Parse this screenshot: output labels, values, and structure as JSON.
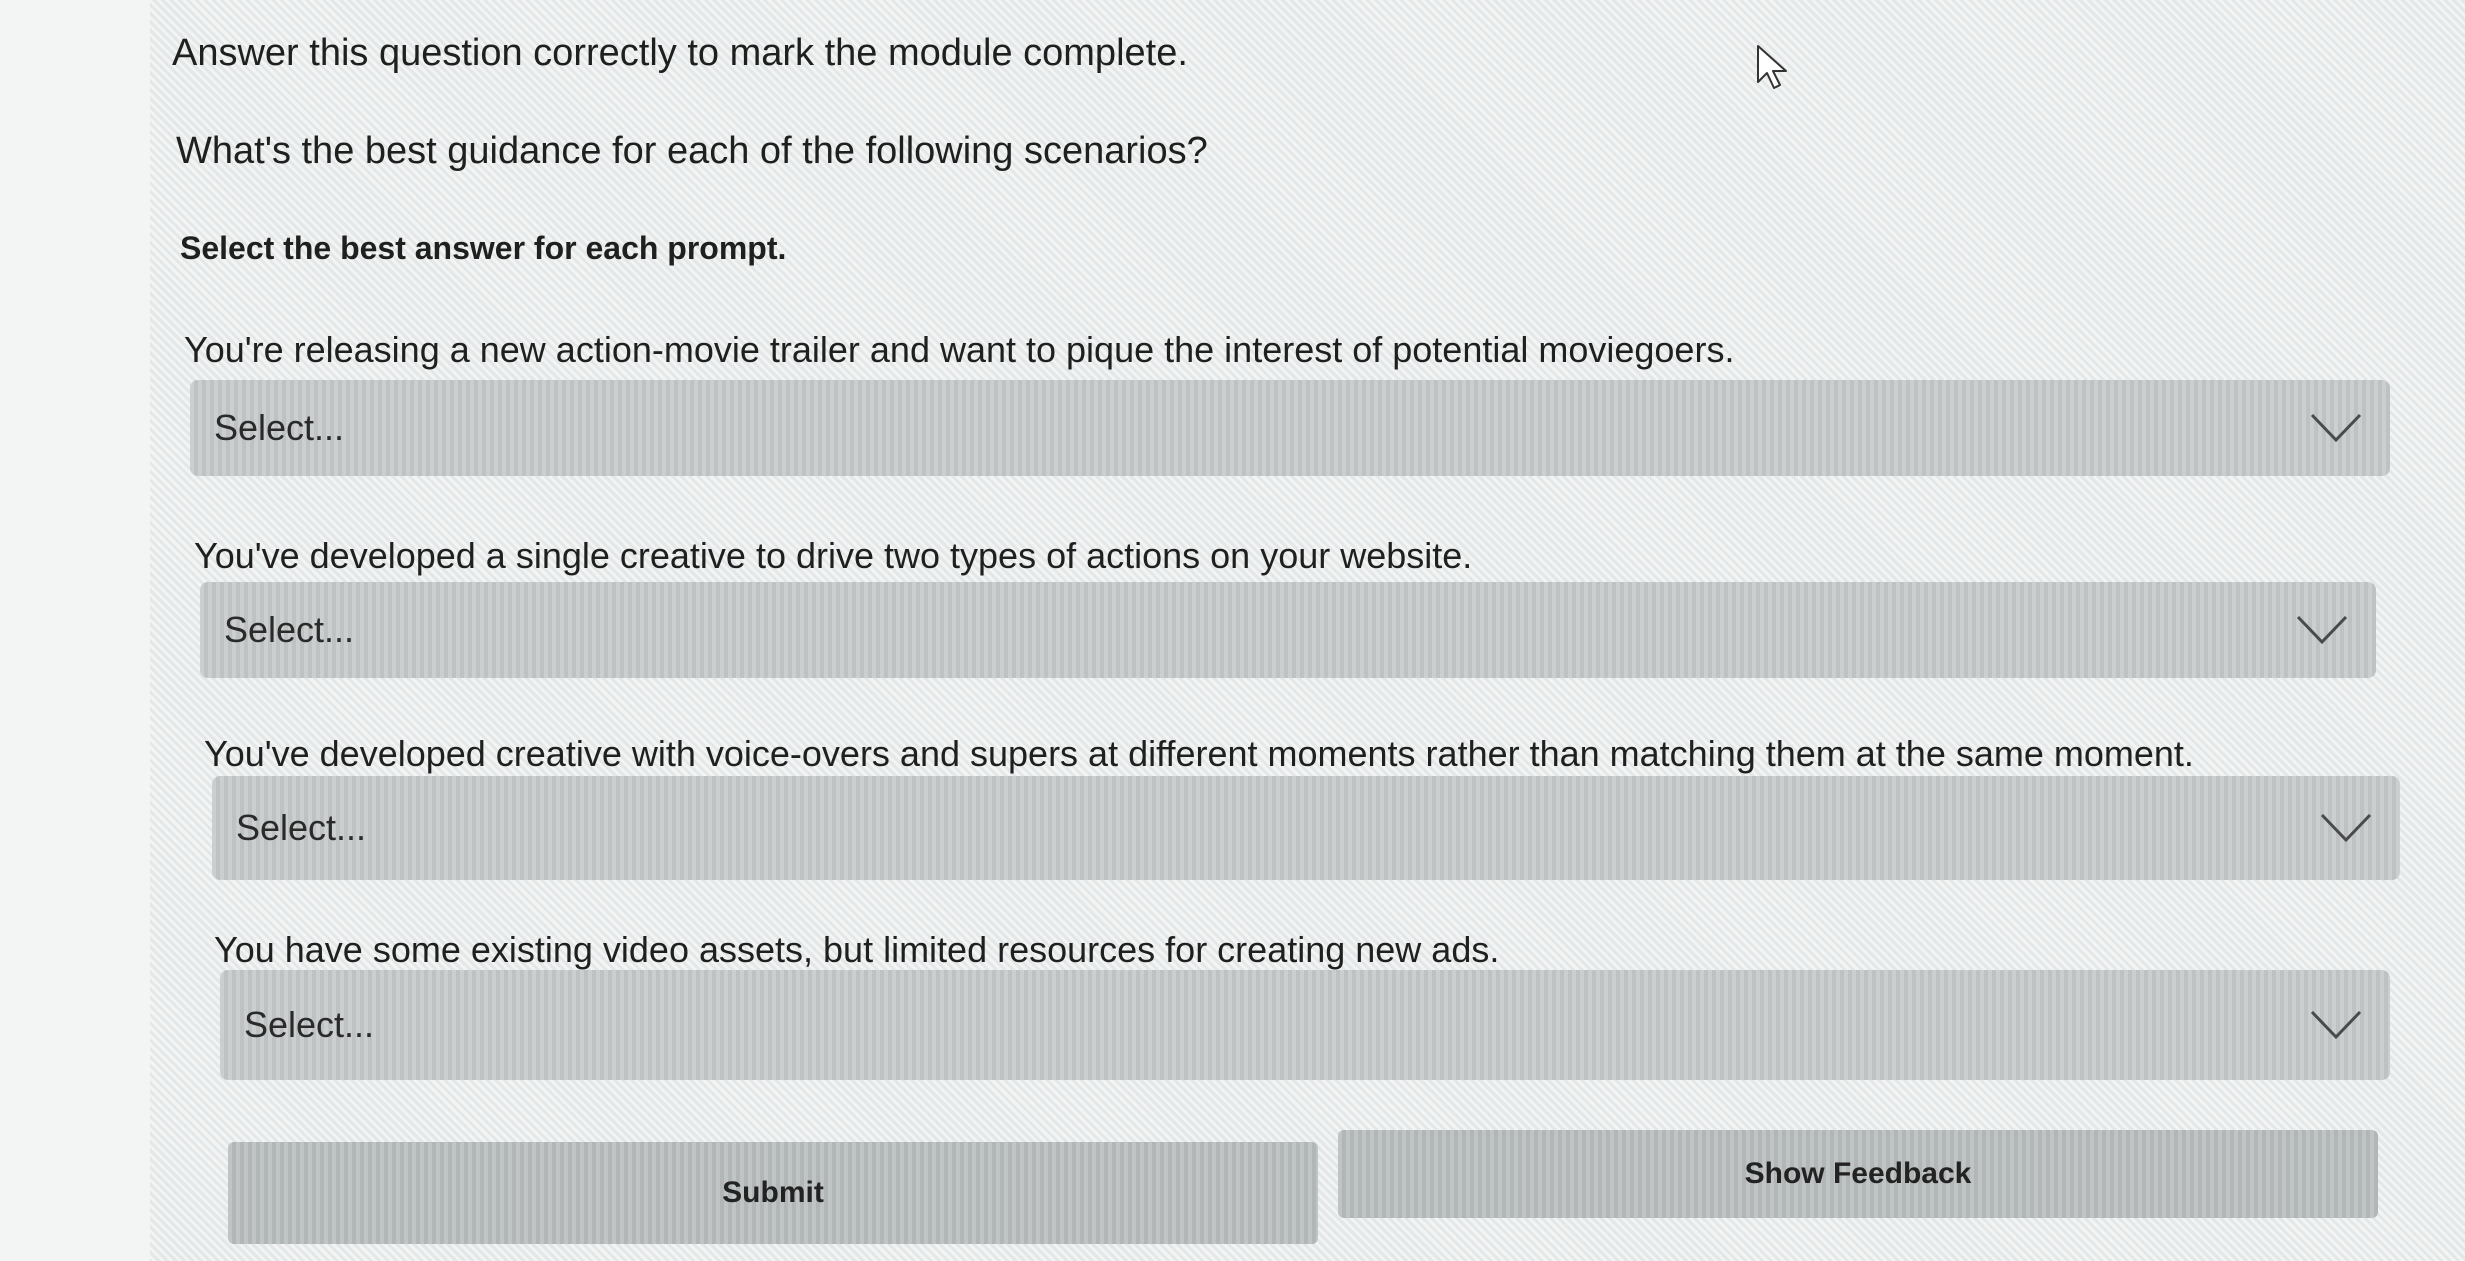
{
  "intro": "Answer this question correctly to mark the module complete.",
  "question": "What's the best guidance for each of the following scenarios?",
  "instruction": "Select the best answer for each prompt.",
  "prompts": [
    {
      "text": "You're releasing a new action-movie trailer and want to pique the interest of potential moviegoers.",
      "select_value": "Select..."
    },
    {
      "text": "You've developed a single creative to drive two types of actions on your website.",
      "select_value": "Select..."
    },
    {
      "text": "You've developed creative with voice-overs and supers at different moments rather than matching them at the same moment.",
      "select_value": "Select..."
    },
    {
      "text": "You have some existing video assets, but limited resources for creating new ads.",
      "select_value": "Select..."
    }
  ],
  "buttons": {
    "submit": "Submit",
    "show_feedback": "Show Feedback"
  },
  "icons": {
    "dropdown": "chevron-down-icon",
    "pointer": "mouse-cursor-icon"
  },
  "colors": {
    "select_bg": "#c4c8c8",
    "button_bg": "#b7bcbc",
    "text": "#1f1f1f"
  }
}
